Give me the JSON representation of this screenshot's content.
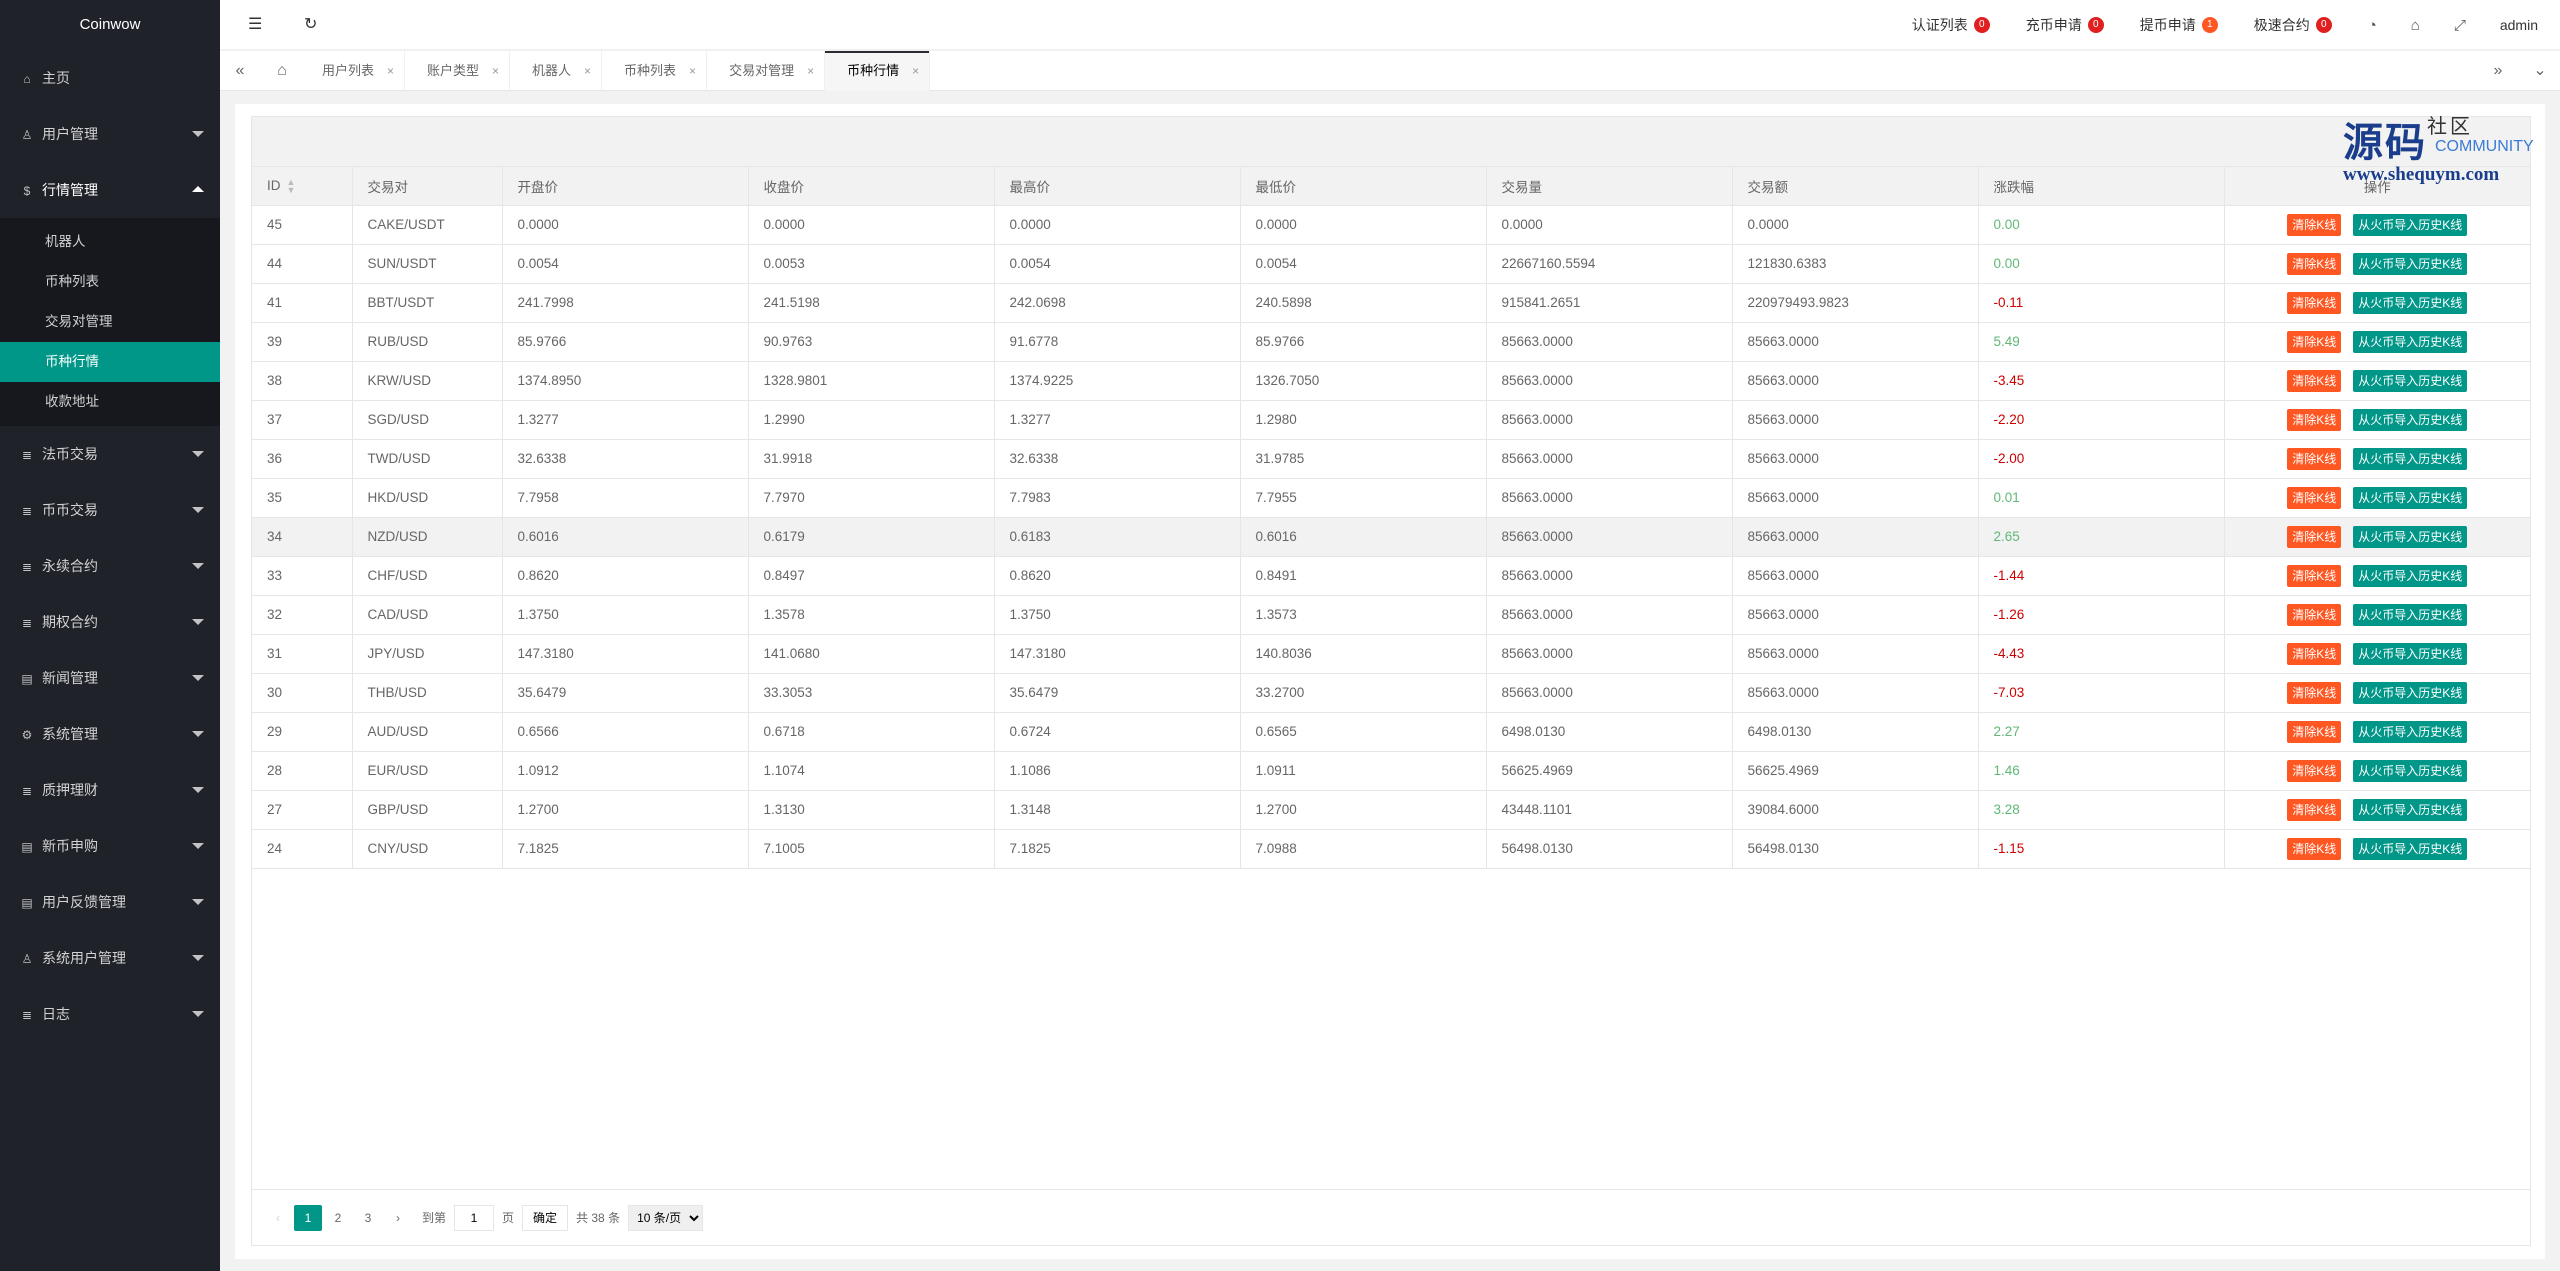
{
  "app": {
    "logo": "Coinwow"
  },
  "sidebar": {
    "items": [
      {
        "label": "主页",
        "icon": "home-icon",
        "glyph": "⌂"
      },
      {
        "label": "用户管理",
        "icon": "user-icon",
        "glyph": "♙"
      },
      {
        "label": "行情管理",
        "icon": "dollar-icon",
        "glyph": "$",
        "open": true,
        "children": [
          "机器人",
          "币种列表",
          "交易对管理",
          "币种行情",
          "收款地址"
        ],
        "active_child": "币种行情"
      },
      {
        "label": "法币交易",
        "icon": "list-icon",
        "glyph": "≣"
      },
      {
        "label": "币币交易",
        "icon": "list-icon",
        "glyph": "≣"
      },
      {
        "label": "永续合约",
        "icon": "list-icon",
        "glyph": "≣"
      },
      {
        "label": "期权合约",
        "icon": "list-icon",
        "glyph": "≣"
      },
      {
        "label": "新闻管理",
        "icon": "news-icon",
        "glyph": "▤"
      },
      {
        "label": "系统管理",
        "icon": "gear-icon",
        "glyph": "⚙"
      },
      {
        "label": "质押理财",
        "icon": "list-icon",
        "glyph": "≣"
      },
      {
        "label": "新币申购",
        "icon": "news-icon",
        "glyph": "▤"
      },
      {
        "label": "用户反馈管理",
        "icon": "news-icon",
        "glyph": "▤"
      },
      {
        "label": "系统用户管理",
        "icon": "user-icon",
        "glyph": "♙"
      },
      {
        "label": "日志",
        "icon": "list-icon",
        "glyph": "≣"
      }
    ]
  },
  "header": {
    "links": [
      {
        "label": "认证列表",
        "count": "0"
      },
      {
        "label": "充币申请",
        "count": "0"
      },
      {
        "label": "提币申请",
        "count": "1"
      },
      {
        "label": "极速合约",
        "count": "0"
      }
    ],
    "user": "admin"
  },
  "tabs": [
    {
      "label": "用户列表"
    },
    {
      "label": "账户类型"
    },
    {
      "label": "机器人"
    },
    {
      "label": "币种列表"
    },
    {
      "label": "交易对管理"
    },
    {
      "label": "币种行情",
      "active": true
    }
  ],
  "watermark": {
    "line1": "源码",
    "line1b": "社区",
    "sub": "COMMUNITY",
    "url": "www.shequym.com"
  },
  "table": {
    "columns": [
      "ID",
      "交易对",
      "开盘价",
      "收盘价",
      "最高价",
      "最低价",
      "交易量",
      "交易额",
      "涨跌幅",
      "操作"
    ],
    "action_labels": {
      "clear": "清除K线",
      "import": "从火币导入历史K线"
    },
    "rows": [
      [
        "45",
        "CAKE/USDT",
        "0.0000",
        "0.0000",
        "0.0000",
        "0.0000",
        "0.0000",
        "0.0000",
        "0.00"
      ],
      [
        "44",
        "SUN/USDT",
        "0.0054",
        "0.0053",
        "0.0054",
        "0.0054",
        "22667160.5594",
        "121830.6383",
        "0.00"
      ],
      [
        "41",
        "BBT/USDT",
        "241.7998",
        "241.5198",
        "242.0698",
        "240.5898",
        "915841.2651",
        "220979493.9823",
        "-0.11"
      ],
      [
        "39",
        "RUB/USD",
        "85.9766",
        "90.9763",
        "91.6778",
        "85.9766",
        "85663.0000",
        "85663.0000",
        "5.49"
      ],
      [
        "38",
        "KRW/USD",
        "1374.8950",
        "1328.9801",
        "1374.9225",
        "1326.7050",
        "85663.0000",
        "85663.0000",
        "-3.45"
      ],
      [
        "37",
        "SGD/USD",
        "1.3277",
        "1.2990",
        "1.3277",
        "1.2980",
        "85663.0000",
        "85663.0000",
        "-2.20"
      ],
      [
        "36",
        "TWD/USD",
        "32.6338",
        "31.9918",
        "32.6338",
        "31.9785",
        "85663.0000",
        "85663.0000",
        "-2.00"
      ],
      [
        "35",
        "HKD/USD",
        "7.7958",
        "7.7970",
        "7.7983",
        "7.7955",
        "85663.0000",
        "85663.0000",
        "0.01"
      ],
      [
        "34",
        "NZD/USD",
        "0.6016",
        "0.6179",
        "0.6183",
        "0.6016",
        "85663.0000",
        "85663.0000",
        "2.65"
      ],
      [
        "33",
        "CHF/USD",
        "0.8620",
        "0.8497",
        "0.8620",
        "0.8491",
        "85663.0000",
        "85663.0000",
        "-1.44"
      ],
      [
        "32",
        "CAD/USD",
        "1.3750",
        "1.3578",
        "1.3750",
        "1.3573",
        "85663.0000",
        "85663.0000",
        "-1.26"
      ],
      [
        "31",
        "JPY/USD",
        "147.3180",
        "141.0680",
        "147.3180",
        "140.8036",
        "85663.0000",
        "85663.0000",
        "-4.43"
      ],
      [
        "30",
        "THB/USD",
        "35.6479",
        "33.3053",
        "35.6479",
        "33.2700",
        "85663.0000",
        "85663.0000",
        "-7.03"
      ],
      [
        "29",
        "AUD/USD",
        "0.6566",
        "0.6718",
        "0.6724",
        "0.6565",
        "6498.0130",
        "6498.0130",
        "2.27"
      ],
      [
        "28",
        "EUR/USD",
        "1.0912",
        "1.1074",
        "1.1086",
        "1.0911",
        "56625.4969",
        "56625.4969",
        "1.46"
      ],
      [
        "27",
        "GBP/USD",
        "1.2700",
        "1.3130",
        "1.3148",
        "1.2700",
        "43448.1101",
        "39084.6000",
        "3.28"
      ],
      [
        "24",
        "CNY/USD",
        "7.1825",
        "7.1005",
        "7.1825",
        "7.0988",
        "56498.0130",
        "56498.0130",
        "-1.15"
      ]
    ],
    "highlighted_row_id": "34"
  },
  "pager": {
    "pages": [
      "1",
      "2",
      "3"
    ],
    "current": "1",
    "goto_label": "到第",
    "goto_value": "1",
    "page_unit": "页",
    "confirm": "确定",
    "total": "共 38 条",
    "page_size": "10 条/页"
  }
}
